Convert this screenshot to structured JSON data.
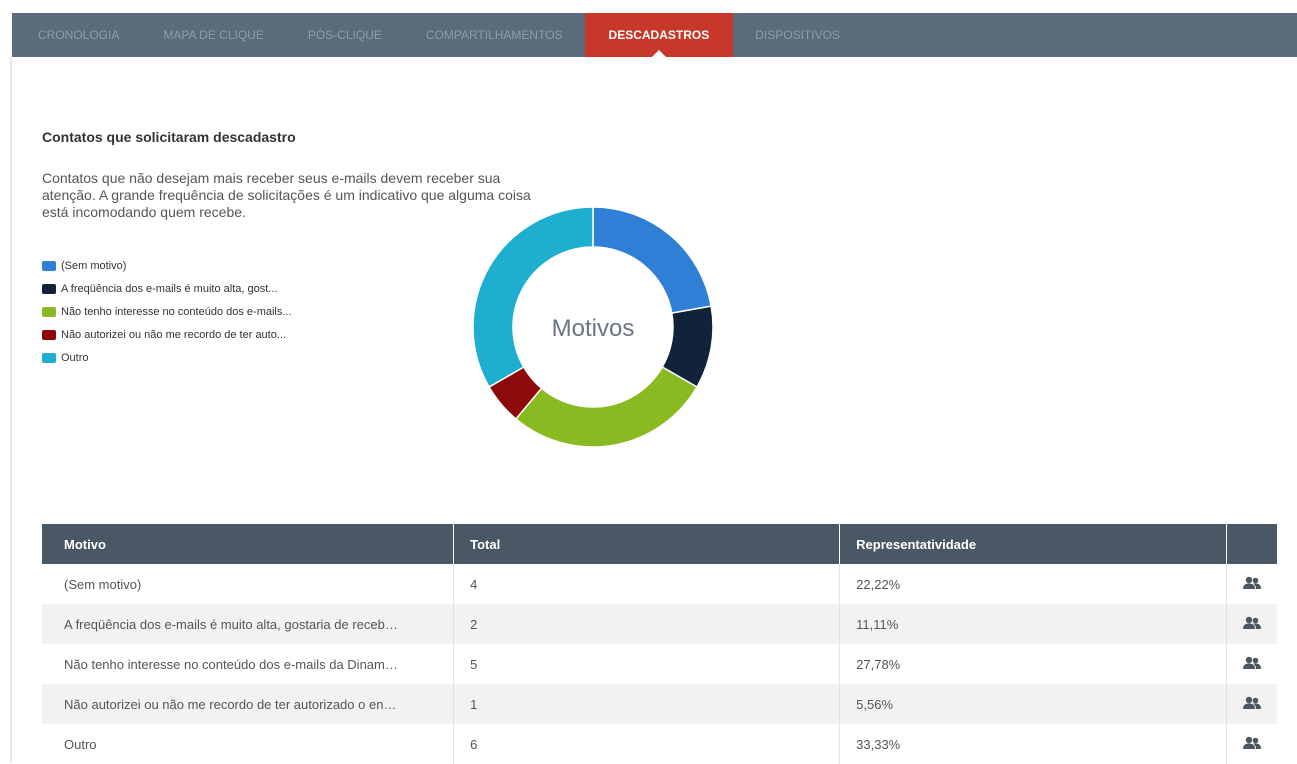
{
  "nav": {
    "tabs": [
      {
        "label": "CRONOLOGIA"
      },
      {
        "label": "MAPA DE CLIQUE"
      },
      {
        "label": "PÓS-CLIQUE"
      },
      {
        "label": "COMPARTILHAMENTOS"
      },
      {
        "label": "DESCADASTROS",
        "active": true
      },
      {
        "label": "DISPOSITIVOS"
      }
    ]
  },
  "section": {
    "title": "Contatos que solicitaram descadastro",
    "description": "Contatos que não desejam mais receber seus e-mails devem receber sua atenção. A grande frequência de solicitações é um indicativo que alguma coisa está incomodando quem recebe."
  },
  "legend": [
    {
      "label": "(Sem motivo)",
      "color": "#2f7fd7"
    },
    {
      "label": "A freqüência dos e-mails é muito alta, gost...",
      "color": "#12223a"
    },
    {
      "label": "Não tenho interesse no conteúdo dos e-mails...",
      "color": "#8aba22"
    },
    {
      "label": "Não autorizei ou não me recordo de ter auto...",
      "color": "#8e0a0a"
    },
    {
      "label": "Outro",
      "color": "#1eaecf"
    }
  ],
  "chart_data": {
    "type": "pie",
    "title": "Motivos",
    "categories": [
      "(Sem motivo)",
      "A freqüência dos e-mails é muito alta, gost...",
      "Não tenho interesse no conteúdo dos e-mails...",
      "Não autorizei ou não me recordo de ter auto...",
      "Outro"
    ],
    "values": [
      4,
      2,
      5,
      1,
      6
    ],
    "colors": [
      "#2f7fd7",
      "#12223a",
      "#8aba22",
      "#8e0a0a",
      "#1eaecf"
    ],
    "donut": true
  },
  "table": {
    "headers": [
      "Motivo",
      "Total",
      "Representatividade",
      ""
    ],
    "rows": [
      {
        "motivo": "(Sem motivo)",
        "total": "4",
        "rep": "22,22%"
      },
      {
        "motivo": "A freqüência dos e-mails é muito alta, gostaria de receb…",
        "total": "2",
        "rep": "11,11%"
      },
      {
        "motivo": "Não tenho interesse no conteúdo dos e-mails da Dinam…",
        "total": "5",
        "rep": "27,78%"
      },
      {
        "motivo": "Não autorizei ou não me recordo de ter autorizado o en…",
        "total": "1",
        "rep": "5,56%"
      },
      {
        "motivo": "Outro",
        "total": "6",
        "rep": "33,33%"
      }
    ],
    "row_icon": "contacts-icon"
  }
}
